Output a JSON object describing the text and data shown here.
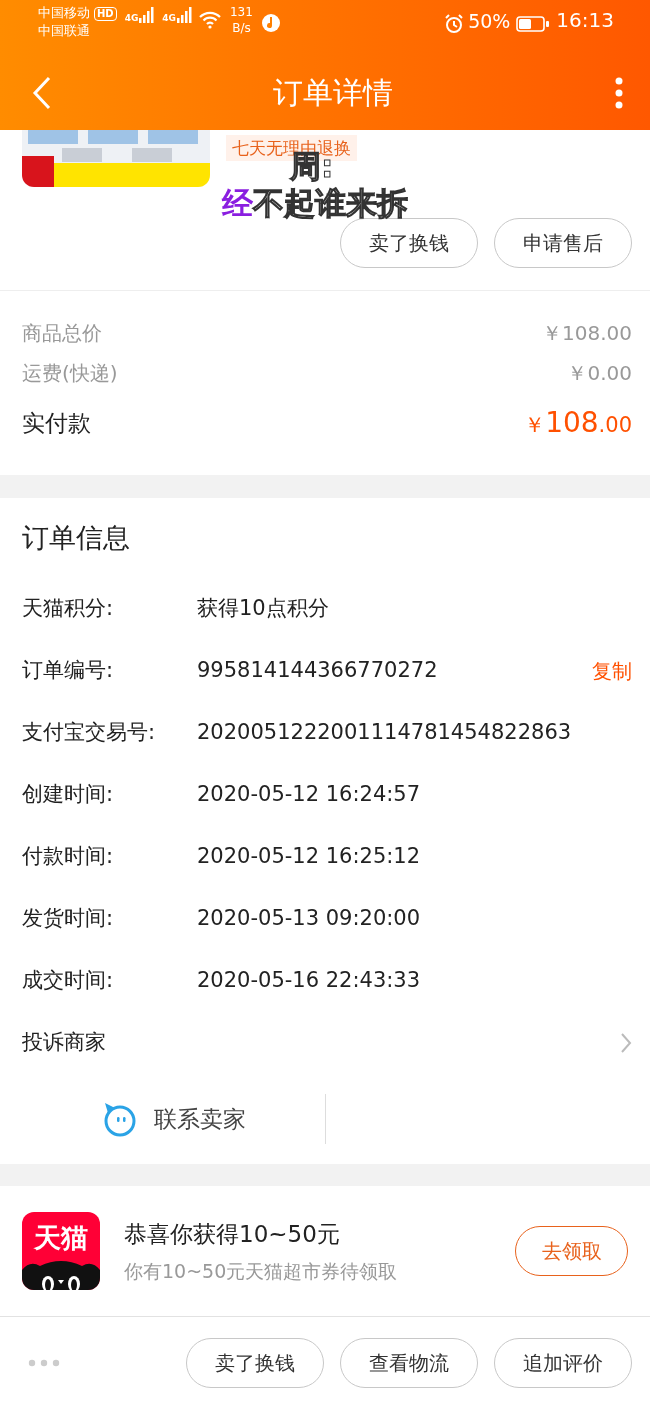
{
  "status_bar": {
    "carriers": [
      "中国移动",
      "中国联通"
    ],
    "hd_badge": "HD",
    "network_labels": [
      "4G",
      "4G"
    ],
    "speed": [
      "131",
      "B/s"
    ],
    "battery_text": "50%",
    "time": "16:13"
  },
  "header": {
    "title": "订单详情"
  },
  "product": {
    "picture": {
      "kind": "picture"
    },
    "service_tag": "七天无理由退换",
    "buttons": [
      "卖了换钱",
      "申请售后"
    ]
  },
  "floating_lyrics": [
    {
      "unsung": "周:"
    },
    {
      "sung": "经",
      "unsung": "不起谁来拆"
    }
  ],
  "price": {
    "rows": [
      {
        "label": "商品总价",
        "value": "￥108.00"
      },
      {
        "label": "运费(快递)",
        "value": "￥0.00"
      }
    ],
    "total": {
      "label": "实付款",
      "currency": "￥",
      "integer": "108",
      "decimals": ".00"
    }
  },
  "order_info": {
    "title": "订单信息",
    "rows": [
      {
        "label": "天猫积分:",
        "value": "获得10点积分"
      },
      {
        "label": "订单编号:",
        "value": "995814144366770272",
        "action": "复制"
      },
      {
        "label": "支付宝交易号:",
        "value": "2020051222001114781454822863"
      },
      {
        "label": "创建时间:",
        "value": "2020-05-12 16:24:57"
      },
      {
        "label": "付款时间:",
        "value": "2020-05-12 16:25:12"
      },
      {
        "label": "发货时间:",
        "value": "2020-05-13 09:20:00"
      },
      {
        "label": "成交时间:",
        "value": "2020-05-16 22:43:33"
      }
    ],
    "complaint": "投诉商家",
    "contact": "联系卖家"
  },
  "promo": {
    "logo_text": "天猫",
    "title": "恭喜你获得10~50元",
    "subtitle": "你有10~50元天猫超市券待领取",
    "button": "去领取"
  },
  "bottom_bar": {
    "buttons": [
      "卖了换钱",
      "查看物流",
      "追加评价"
    ]
  }
}
